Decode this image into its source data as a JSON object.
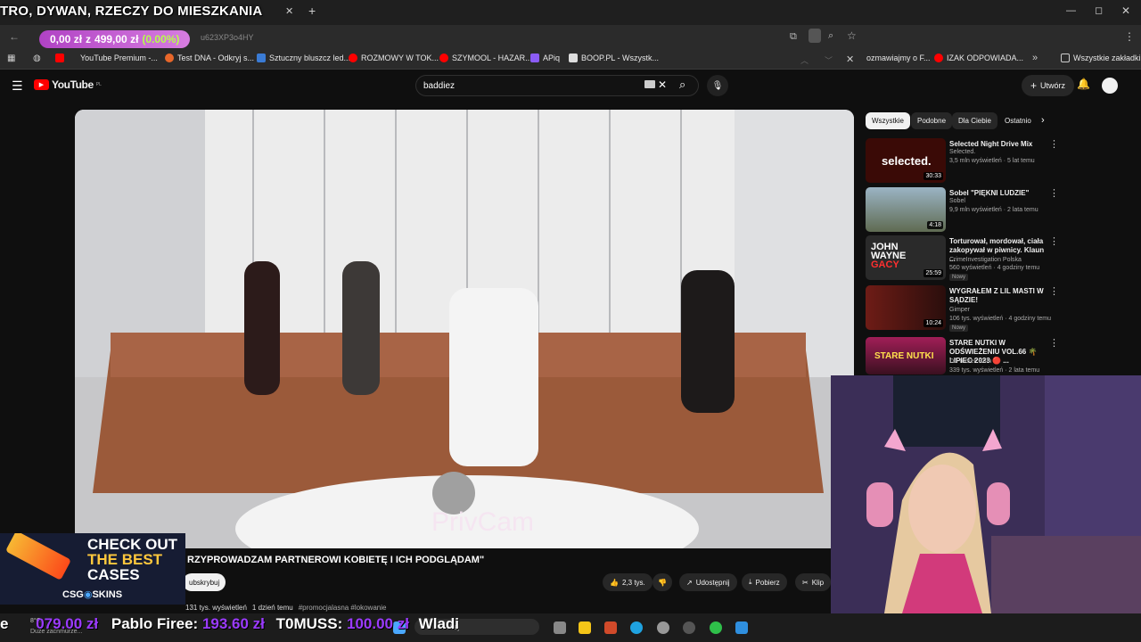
{
  "stream_overlay": {
    "title": "TRO, DYWAN, RZECZY DO MIESZKANIA",
    "money_current": "0,00 zł",
    "money_separator": "z",
    "money_goal": "499,00 zł",
    "money_percent": "(0.00%)",
    "url_fragment": "u623XP3o4HY",
    "ticker": {
      "prefix": "e",
      "amount1": "079.00 zł",
      "name2": "Pablo Firee:",
      "amount2": "193.60 zł",
      "name3": "T0MUSS:",
      "amount3": "100.00 zł",
      "name4": "Wladi"
    },
    "csgo_ad": {
      "line1": "CHECK OUT",
      "line2": "THE BEST",
      "line3": "CASES",
      "brand": "CSG",
      "brand2": "SKINS"
    }
  },
  "bookmarks": [
    {
      "label": "YouTube Premium -...",
      "color": "#ff0000"
    },
    {
      "label": "Test DNA - Odkryj s...",
      "color": "#e8672a"
    },
    {
      "label": "Sztuczny bluszcz led...",
      "color": "#3a7bd5"
    },
    {
      "label": "ROZMOWY W TOK...",
      "color": "#ff0000"
    },
    {
      "label": "SZYMOOL - HAZAR...",
      "color": "#ff0000"
    },
    {
      "label": "APiq",
      "color": "#8b5cf6"
    },
    {
      "label": "BOOP.PL - Wszystk...",
      "color": "#dddddd"
    },
    {
      "label": "ozmawiajmy o F...",
      "color": "#ff0000"
    },
    {
      "label": "IZAK ODPOWIADA...",
      "color": "#ff0000"
    }
  ],
  "all_bookmarks_label": "Wszystkie zakładki",
  "youtube": {
    "logo": "YouTube",
    "logo_sup": "PL",
    "search_value": "baddiez",
    "create_label": "Utwórz",
    "video_watermark": "PrivCam",
    "video_title": "RZYPROWADZAM PARTNEROWI KOBIETĘ I ICH PODGLĄDAM\"",
    "subscribe_label": "ubskrybuj",
    "likes": "2,3 tys.",
    "share_label": "Udostępnij",
    "download_label": "Pobierz",
    "clip_label": "Klip",
    "views_line": "131 tys. wyświetleń",
    "date_line": "1 dzień temu",
    "tags": "#promocjalasna #lokowanie",
    "chips": [
      "Wszystkie",
      "Podobne",
      "Dla Ciebie",
      "Ostatnio"
    ],
    "recommendations": [
      {
        "title": "Selected Night Drive Mix",
        "channel": "Selected.",
        "meta": "3,5 mln wyświetleń · 5 lat temu",
        "duration": "30:33",
        "badge": "",
        "thumb_color": "#3a0a06"
      },
      {
        "title": "Sobel \"PIĘKNI LUDZIE\"",
        "channel": "Sobel",
        "meta": "9,9 mln wyświetleń · 2 lata temu",
        "duration": "4:18",
        "badge": "",
        "thumb_color": "#8aa3b4"
      },
      {
        "title": "Torturował, mordował, ciała zakopywał w piwnicy. Klaun ...",
        "channel": "CrimeInvestigation Polska",
        "meta": "560 wyświetleń · 4 godziny temu",
        "duration": "25:59",
        "badge": "Nowy",
        "thumb_color": "#2a2a2a"
      },
      {
        "title": "WYGRAŁEM Z LIL MASTI W SĄDZIE!",
        "channel": "Gimper",
        "meta": "106 tys. wyświetleń · 4 godziny temu",
        "duration": "10:24",
        "badge": "Nowy",
        "thumb_color": "#5a1a14"
      },
      {
        "title": "STARE NUTKI W ODŚWIEŻENIU VOL.66 🌴 LIPIEC 2023 🔴 ...",
        "channel": "DJ Tomek Edm",
        "meta": "339 tys. wyświetleń · 2 lata temu",
        "duration": "",
        "badge": "",
        "thumb_color": "#7a1a3a"
      }
    ]
  },
  "taskbar": {
    "weather_temp": "8°C",
    "weather_desc": "Duże zachmurze...",
    "search_placeholder": "kaj"
  }
}
